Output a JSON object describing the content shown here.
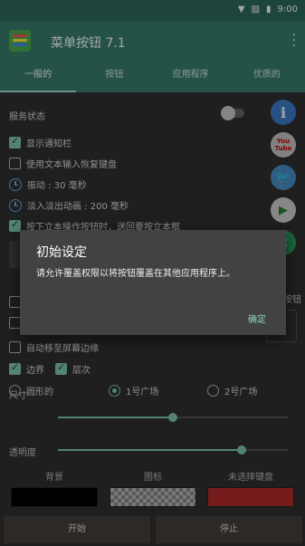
{
  "status_bar": {
    "time": "9:00"
  },
  "app": {
    "title": "菜单按钮 7.1"
  },
  "tabs": [
    {
      "label": "一般的"
    },
    {
      "label": "按钮"
    },
    {
      "label": "应用程序"
    },
    {
      "label": "优质的"
    }
  ],
  "settings": {
    "service_status_label": "服务状态",
    "show_notification_label": "显示通知栏",
    "restore_keyboard_label": "使用文本输入恢复键盘",
    "vibration_label": "振动 : 30 毫秒",
    "fade_label": "淡入淡出动画 : 200 毫秒",
    "hidden_text_1": "按下立本操作按钮时，送回要按立本框",
    "hidden_text_2": "按钮",
    "auto_move_label": "自动移至屏幕边缘",
    "border_label": "边界",
    "level_label": "层次",
    "shape_options": [
      "圆形的",
      "1号广场",
      "2号广场"
    ],
    "size_label": "尺寸",
    "size_value": 0.5,
    "opacity_label": "透明度",
    "opacity_value": 0.8,
    "background_label": "背景",
    "icon_label": "图标",
    "keyboard_label": "未选择键盘",
    "background_color": "#000000",
    "keyboard_color": "#b52a2a"
  },
  "social_icons": [
    {
      "name": "info",
      "glyph": "i",
      "color": "#3d7cc9"
    },
    {
      "name": "youtube",
      "glyph": "You Tube",
      "color": "#c7c7c7"
    },
    {
      "name": "twitter",
      "glyph": "🐦",
      "color": "#4a90c8"
    },
    {
      "name": "play-store",
      "glyph": "▶",
      "color": "#d0d0d0"
    },
    {
      "name": "share",
      "glyph": "<",
      "color": "#2a9d5c"
    }
  ],
  "buttons": {
    "start": "开始",
    "stop": "停止"
  },
  "dialog": {
    "title": "初始设定",
    "message": "请允许覆盖权限以将按钮覆盖在其他应用程序上。",
    "ok": "确定"
  }
}
